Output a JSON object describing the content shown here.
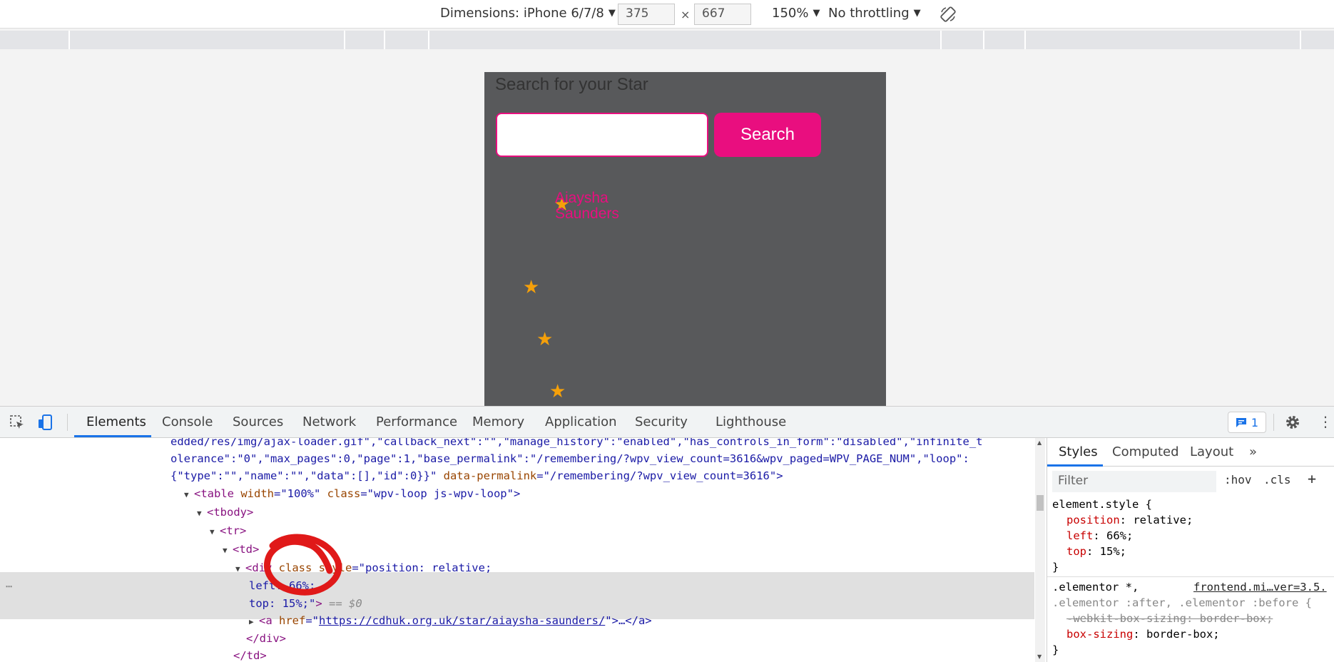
{
  "device_toolbar": {
    "dimensions_label": "Dimensions: iPhone 6/7/8",
    "width": "375",
    "height": "667",
    "times": "×",
    "zoom": "150%",
    "throttling": "No throttling"
  },
  "page": {
    "title": "Search for your Star",
    "search_button": "Search",
    "star_name_line1": "Aiaysha",
    "star_name_line2": "Saunders",
    "accent_color": "#e90e7f",
    "background_color": "#58595b",
    "star_color": "#f5a00a"
  },
  "devtools": {
    "tabs": [
      "Elements",
      "Console",
      "Sources",
      "Network",
      "Performance",
      "Memory",
      "Application",
      "Security",
      "Lighthouse"
    ],
    "issues_count": "1",
    "dom_lines": {
      "l1": "edded/res/img/ajax-loader.gif\",\"callback_next\":\"\",\"manage_history\":\"enabled\",\"has_controls_in_form\":\"disabled\",\"infinite_t",
      "l2": "olerance\":\"0\",\"max_pages\":0,\"page\":1,\"base_permalink\":\"/remembering/?wpv_view_count=3616&wpv_paged=WPV_PAGE_NUM\",\"loop\":",
      "l3a": "{\"type\":\"\",\"name\":\"\",\"data\":[],\"id\":0}}\"",
      "l3b": " data-permalink",
      "l3c": "=\"/remembering/?wpv_view_count=3616\">",
      "table_tag": "<table",
      "table_width_attr": " width",
      "table_width_val": "=\"100%\"",
      "table_class_attr": " class",
      "table_class_val": "=\"wpv-loop js-wpv-loop\">",
      "tbody": "<tbody>",
      "tr": "<tr>",
      "td": "<td>",
      "div_open": "<div",
      "div_class": " class",
      "div_style": " style",
      "div_style_val": "=\"position: relative;",
      "div_style_left": "left: 66%;",
      "div_style_top": "top: 15%;\"",
      "div_close_bracket": ">",
      "selected_marker": " == $0",
      "a_open": "<a",
      "a_href": " href",
      "a_eq": "=\"",
      "a_link": "https://cdhuk.org.uk/star/aiaysha-saunders/",
      "a_end": "\">…</a>",
      "div_end": "</div>",
      "td_end": "</td>"
    },
    "styles_tabs": [
      "Styles",
      "Computed",
      "Layout"
    ],
    "filter_placeholder": "Filter",
    "hov": ":hov",
    "cls": ".cls",
    "element_style_selector": "element.style {",
    "rules": {
      "position_prop": "position",
      "position_val": ": relative;",
      "left_prop": "left",
      "left_val": ": 66%;",
      "top_prop": "top",
      "top_val": ": 15%;",
      "close": "}",
      "elementor_selector1": ".elementor *,",
      "elementor_source": "frontend.mi…ver=3.5.",
      "elementor_selector2": ".elementor :after, .elementor :before {",
      "webkit_prop": "-webkit-box-sizing",
      "webkit_val": ": border-box;",
      "boxsizing_prop": "box-sizing",
      "boxsizing_val": ": border-box;",
      "close2": "}"
    }
  }
}
